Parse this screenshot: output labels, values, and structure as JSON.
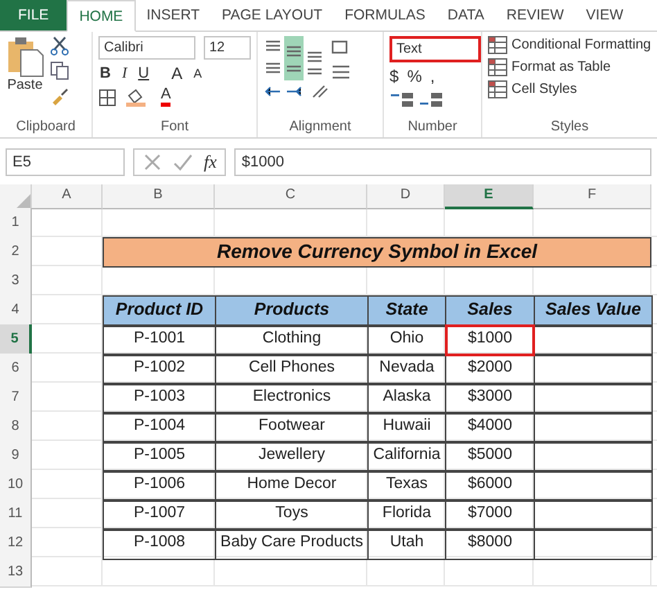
{
  "tabs": [
    {
      "label": "FILE",
      "kind": "file",
      "selected": false
    },
    {
      "label": "HOME",
      "kind": "tab",
      "selected": true
    },
    {
      "label": "INSERT",
      "kind": "tab",
      "selected": false
    },
    {
      "label": "PAGE LAYOUT",
      "kind": "tab",
      "selected": false
    },
    {
      "label": "FORMULAS",
      "kind": "tab",
      "selected": false
    },
    {
      "label": "DATA",
      "kind": "tab",
      "selected": false
    },
    {
      "label": "REVIEW",
      "kind": "tab",
      "selected": false
    },
    {
      "label": "VIEW",
      "kind": "tab",
      "selected": false
    }
  ],
  "ribbon": {
    "clipboard": {
      "paste": "Paste",
      "label": "Clipboard"
    },
    "font": {
      "font_name": "Calibri",
      "font_size": "12",
      "bold": "B",
      "italic": "I",
      "underline": "U",
      "grow": "A",
      "shrink": "A",
      "font_color": "A",
      "label": "Font"
    },
    "alignment": {
      "label": "Alignment"
    },
    "number": {
      "format": "Text",
      "format_highlighted": true,
      "currency": "$",
      "percent": "%",
      "comma": ",",
      "label": "Number"
    },
    "styles": {
      "items": [
        "Conditional Formatting",
        "Format as Table",
        "Cell Styles"
      ],
      "label": "Styles"
    }
  },
  "formula_bar": {
    "name_box": "E5",
    "fx": "fx",
    "value": "$1000"
  },
  "sheet": {
    "columns": [
      {
        "label": "A",
        "selected": false
      },
      {
        "label": "B",
        "selected": false
      },
      {
        "label": "C",
        "selected": false
      },
      {
        "label": "D",
        "selected": false
      },
      {
        "label": "E",
        "selected": true
      },
      {
        "label": "F",
        "selected": false
      }
    ],
    "row_numbers": [
      {
        "label": "1",
        "selected": false
      },
      {
        "label": "2",
        "selected": false
      },
      {
        "label": "3",
        "selected": false
      },
      {
        "label": "4",
        "selected": false
      },
      {
        "label": "5",
        "selected": true
      },
      {
        "label": "6",
        "selected": false
      },
      {
        "label": "7",
        "selected": false
      },
      {
        "label": "8",
        "selected": false
      },
      {
        "label": "9",
        "selected": false
      },
      {
        "label": "10",
        "selected": false
      },
      {
        "label": "11",
        "selected": false
      },
      {
        "label": "12",
        "selected": false
      },
      {
        "label": "13",
        "selected": false
      }
    ],
    "title": "Remove Currency Symbol in Excel",
    "table": {
      "columns": [
        "Product ID",
        "Products",
        "State",
        "Sales",
        "Sales Value"
      ],
      "rows": [
        {
          "product_id": "P-1001",
          "product": "Clothing",
          "state": "Ohio",
          "sales": "$1000",
          "sales_selected": true
        },
        {
          "product_id": "P-1002",
          "product": "Cell Phones",
          "state": "Nevada",
          "sales": "$2000",
          "sales_selected": false
        },
        {
          "product_id": "P-1003",
          "product": "Electronics",
          "state": "Alaska",
          "sales": "$3000",
          "sales_selected": false
        },
        {
          "product_id": "P-1004",
          "product": "Footwear",
          "state": "Huwaii",
          "sales": "$4000",
          "sales_selected": false
        },
        {
          "product_id": "P-1005",
          "product": "Jewellery",
          "state": "California",
          "sales": "$5000",
          "sales_selected": false
        },
        {
          "product_id": "P-1006",
          "product": "Home Decor",
          "state": "Texas",
          "sales": "$6000",
          "sales_selected": false
        },
        {
          "product_id": "P-1007",
          "product": "Toys",
          "state": "Florida",
          "sales": "$7000",
          "sales_selected": false
        },
        {
          "product_id": "P-1008",
          "product": "Baby Care Products",
          "state": "Utah",
          "sales": "$8000",
          "sales_selected": false
        }
      ]
    }
  }
}
